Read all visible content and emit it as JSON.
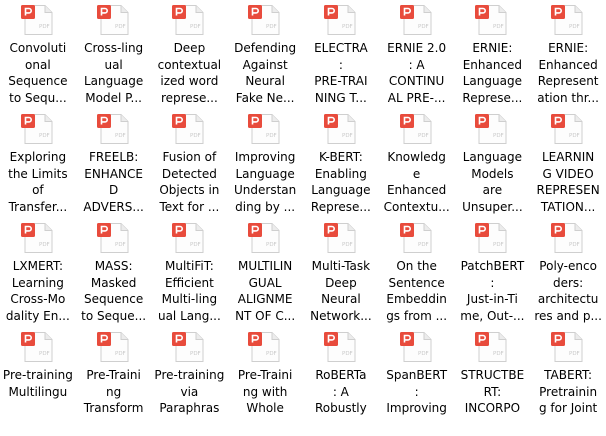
{
  "icon_name": "pdf-file-icon",
  "icon_badge_text": "PDF",
  "colors": {
    "accent": "#e84b3c",
    "page": "#ffffff",
    "text": "#000000"
  },
  "files": [
    {
      "label": "Convoluti\nonal\nSequence\nto Sequ..."
    },
    {
      "label": "Cross-ling\nual\nLanguage\nModel P..."
    },
    {
      "label": "Deep\ncontextual\nized word\nreprese..."
    },
    {
      "label": "Defending\nAgainst\nNeural\nFake Ne..."
    },
    {
      "label": "ELECTRA\n:\nPRE-TRAI\nNING T..."
    },
    {
      "label": "ERNIE 2.0\n: A\nCONTINU\nAL PRE-..."
    },
    {
      "label": "ERNIE:\nEnhanced\nLanguage\nReprese..."
    },
    {
      "label": "ERNIE:\nEnhanced\nRepresent\nation thr..."
    },
    {
      "label": "Exploring\nthe Limits\nof\nTransfer..."
    },
    {
      "label": "FREELB:\nENHANCE\nD\nADVERS..."
    },
    {
      "label": "Fusion of\nDetected\nObjects in\nText for ..."
    },
    {
      "label": "Improving\nLanguage\nUnderstan\nding by ..."
    },
    {
      "label": "K-BERT:\nEnabling\nLanguage\nReprese..."
    },
    {
      "label": "Knowledg\ne\nEnhanced\nContextu..."
    },
    {
      "label": "Language\nModels\nare\nUnsuper..."
    },
    {
      "label": "LEARNIN\nG VIDEO\nREPRESEN\nTATION..."
    },
    {
      "label": "LXMERT:\nLearning\nCross-Mo\ndality En..."
    },
    {
      "label": "MASS:\nMasked\nSequence\nto Seque..."
    },
    {
      "label": "MultiFiT:\nEfficient\nMulti-ling\nual Lang..."
    },
    {
      "label": "MULTILIN\nGUAL\nALIGNME\nNT OF C..."
    },
    {
      "label": "Multi-Task\nDeep\nNeural\nNetwork..."
    },
    {
      "label": "On the\nSentence\nEmbeddin\ngs from ..."
    },
    {
      "label": "PatchBERT\n:\nJust-in-Ti\nme, Out-..."
    },
    {
      "label": "Poly-enco\nders:\narchitectu\nres and p..."
    },
    {
      "label": "Pre-training\nMultilingu"
    },
    {
      "label": "Pre-Traini\nng\nTransform"
    },
    {
      "label": "Pre-training\nvia\nParaphras"
    },
    {
      "label": "Pre-Traini\nng with\nWhole"
    },
    {
      "label": "RoBERTa\n: A\nRobustly"
    },
    {
      "label": "SpanBERT\n:\nImproving"
    },
    {
      "label": "STRUCTBE\nRT:\nINCORPO"
    },
    {
      "label": "TABERT:\nPretrainin\ng for Joint"
    }
  ]
}
